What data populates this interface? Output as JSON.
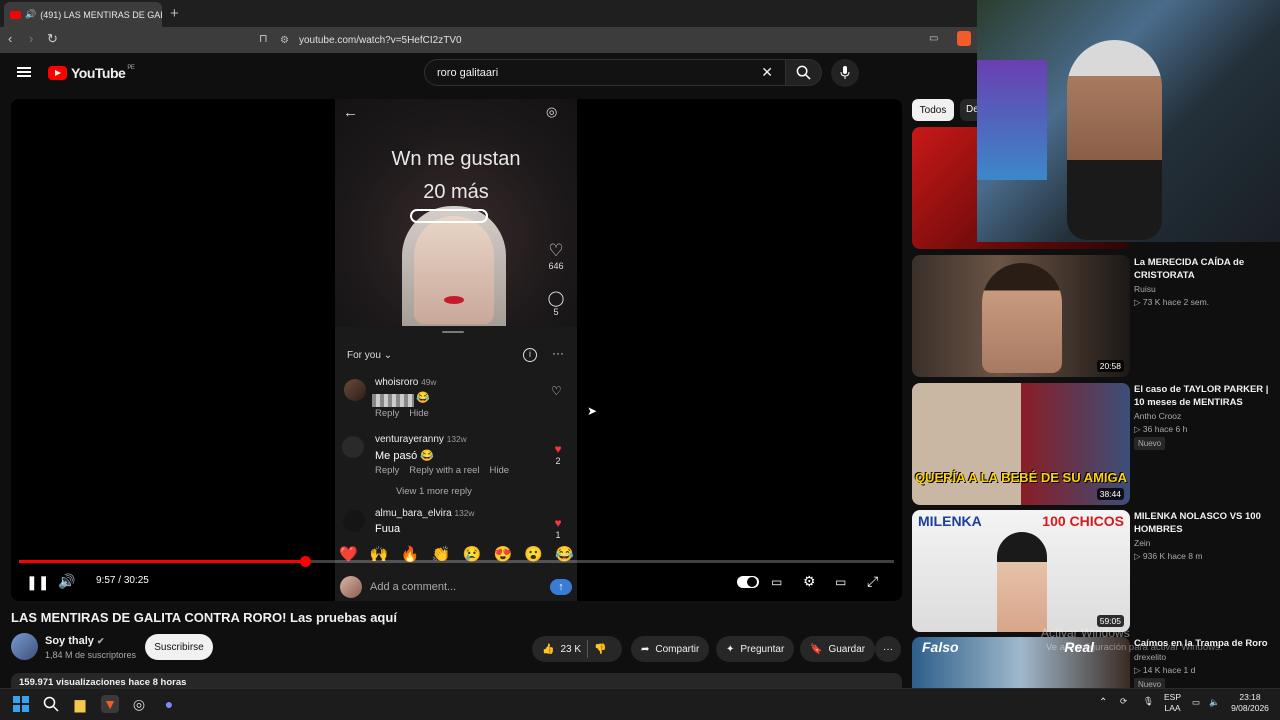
{
  "browser": {
    "tab_title": "(491) LAS MENTIRAS DE GALI",
    "url": "youtube.com/watch?v=5HefCI2zTV0"
  },
  "youtube": {
    "region": "PE",
    "search_query": "roro galitaari"
  },
  "video_content": {
    "caption_line1": "Wn me gustan",
    "caption_line2": "20 más",
    "likes": "646",
    "comments": "5",
    "for_you": "For you",
    "comment_list": [
      {
        "user": "whoisroro",
        "age": "49w",
        "text": "",
        "actions": [
          "Reply",
          "Hide"
        ],
        "likes": ""
      },
      {
        "user": "venturayeranny",
        "age": "132w",
        "text": "Me pasó 😂",
        "actions": [
          "Reply",
          "Reply with a reel",
          "Hide"
        ],
        "likes": "2"
      },
      {
        "user": "almu_bara_elvira",
        "age": "132w",
        "text": "Fuua",
        "actions": [],
        "likes": "1"
      }
    ],
    "view_more_replies": "View 1 more reply",
    "emojis": [
      "❤️",
      "🙌",
      "🔥",
      "👏",
      "😢",
      "😍",
      "😮",
      "😂"
    ],
    "add_comment_placeholder": "Add a comment..."
  },
  "player": {
    "current_time": "9:57",
    "duration": "30:25",
    "progress_fraction": 0.327
  },
  "video": {
    "title": "LAS MENTIRAS DE GALITA CONTRA RORO! Las pruebas aquí",
    "channel_name": "Soy thaly",
    "subscribers": "1,84 M de suscriptores",
    "subscribe_label": "Suscribirse",
    "likes": "23 K",
    "share_label": "Compartir",
    "ask_label": "Preguntar",
    "save_label": "Guardar",
    "views_and_age": "159.971 visualizaciones  hace 8 horas"
  },
  "sidebar": {
    "chip_all": "Todos",
    "chip_partial": "De",
    "recommendations": [
      {
        "title": "",
        "channel": "",
        "meta": "",
        "duration": ""
      },
      {
        "title": "La MERECIDA CAÍDA de CRISTORATA",
        "channel": "Ruisu",
        "meta": "▷ 73 K  hace 2 sem.",
        "duration": "20:58",
        "badge": ""
      },
      {
        "title": "El caso de TAYLOR PARKER | 10 meses de MENTIRAS",
        "channel": "Antho Crooz",
        "meta": "▷ 36  hace 6 h",
        "duration": "38:44",
        "badge": "Nuevo",
        "thumb_text": "QUERÍA A LA BEBÉ DE SU AMIGA"
      },
      {
        "title": "MILENKA NOLASCO VS 100 HOMBRES",
        "channel": "Zein",
        "meta": "▷ 936 K  hace 8 m",
        "duration": "59:05",
        "badge": "",
        "thumb_text_left": "MILENKA",
        "thumb_text_right": "100 CHICOS"
      },
      {
        "title": "Caímos en la Trampa de Roro",
        "channel": "drexelito",
        "meta": "▷ 14 K  hace 1 d",
        "duration": "",
        "badge": "Nuevo",
        "thumb_text_left": "Falso",
        "thumb_text_right": "Real"
      }
    ]
  },
  "watermark": {
    "line1": "Activar Windows",
    "line2": "Ve a Configuración para activar Windows."
  },
  "taskbar": {
    "lang_line1": "ESP",
    "lang_line2": "LAA",
    "clock_time": "23:18",
    "clock_date": "9/08/2026"
  }
}
